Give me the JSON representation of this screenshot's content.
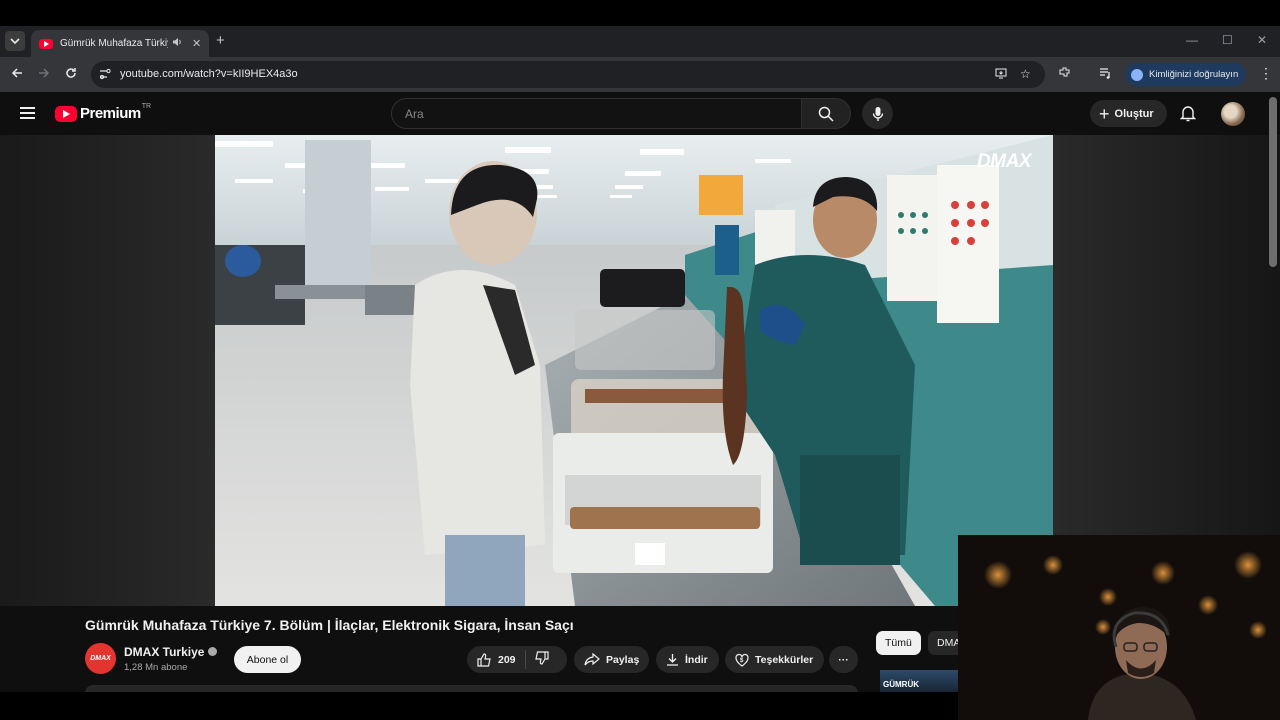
{
  "browser": {
    "tab": {
      "title": "Gümrük Muhafaza Türkiye"
    },
    "url": "youtube.com/watch?v=kII9HEX4a3o",
    "verify_label": "Kimliğinizi doğrulayın"
  },
  "masthead": {
    "logo_word": "Premium",
    "country_code": "TR",
    "search_placeholder": "Ara",
    "create_label": "Oluştur"
  },
  "video": {
    "watermark": "DMAX",
    "title": "Gümrük Muhafaza Türkiye 7. Bölüm | İlaçlar, Elektronik Sigara, İnsan Saçı"
  },
  "channel": {
    "name": "DMAX Turkiye",
    "subscribers": "1,28 Mn abone",
    "avatar_text": "DMAX",
    "subscribe_label": "Abone ol"
  },
  "actions": {
    "like_count": "209",
    "share_label": "Paylaş",
    "download_label": "İndir",
    "thanks_label": "Teşekkürler"
  },
  "sidebar": {
    "chips": [
      "Tümü",
      "DMAX"
    ],
    "thumb_text": "GÜMRÜK"
  },
  "colors": {
    "brand_red": "#ff0033",
    "background": "#0f0f0f",
    "officer_uniform": "#1f5a5c"
  },
  "icons": [
    "tab-list-icon",
    "youtube-favicon",
    "audio-icon",
    "close-tab-icon",
    "new-tab-icon",
    "minimize-icon",
    "maximize-icon",
    "window-close-icon",
    "back-icon",
    "forward-icon",
    "reload-icon",
    "site-info-icon",
    "install-app-icon",
    "bookmark-star-icon",
    "extensions-icon",
    "media-controls-icon",
    "kebab-menu-icon",
    "hamburger-menu-icon",
    "search-icon",
    "microphone-icon",
    "plus-icon",
    "notifications-bell-icon",
    "verified-check-icon",
    "thumbs-up-icon",
    "thumbs-down-icon",
    "share-icon",
    "download-icon",
    "thanks-icon",
    "more-icon"
  ]
}
